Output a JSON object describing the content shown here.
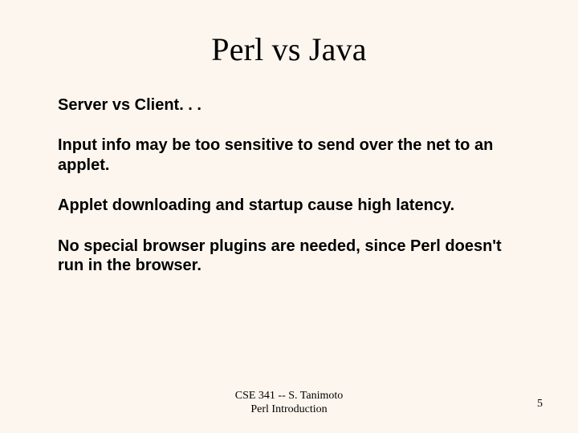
{
  "title": "Perl vs Java",
  "paragraphs": [
    "Server vs Client. . .",
    "Input info may be too sensitive to send over the net to an applet.",
    "Applet downloading and startup cause high latency.",
    "No special browser plugins are needed, since Perl doesn't run in the browser."
  ],
  "footer": {
    "line1": "CSE 341 -- S. Tanimoto",
    "line2": "Perl Introduction"
  },
  "page_number": "5"
}
